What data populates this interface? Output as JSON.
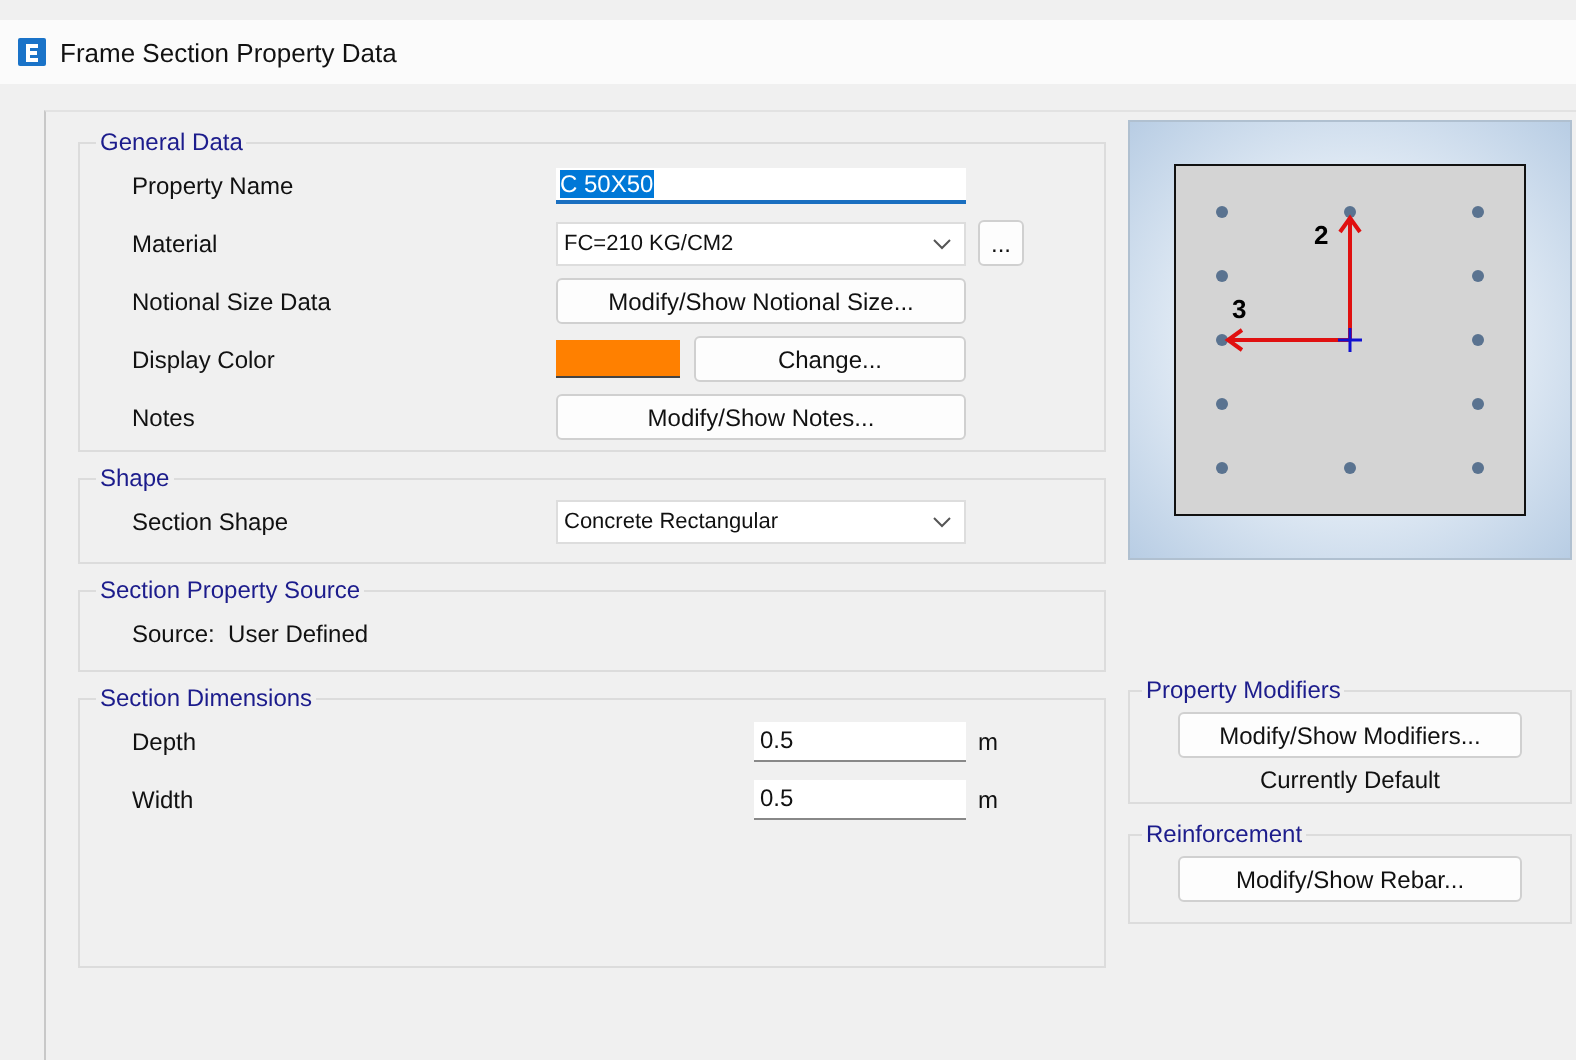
{
  "window": {
    "title": "Frame Section Property Data"
  },
  "general_data": {
    "title": "General Data",
    "rows": [
      {
        "label": "Property Name",
        "kind": "text",
        "value": "C 50X50",
        "selected": true
      },
      {
        "label": "Material",
        "kind": "dropdown",
        "value": "FC=210 KG/CM2",
        "extra_button": "..."
      },
      {
        "label": "Notional Size Data",
        "kind": "button",
        "button": "Modify/Show Notional Size..."
      },
      {
        "label": "Display Color",
        "kind": "color",
        "color": "#ff8000",
        "button": "Change..."
      },
      {
        "label": "Notes",
        "kind": "button",
        "button": "Modify/Show Notes..."
      }
    ]
  },
  "shape": {
    "title": "Shape",
    "label": "Section Shape",
    "value": "Concrete Rectangular"
  },
  "source": {
    "title": "Section Property Source",
    "text": "Source:  User Defined"
  },
  "dimensions": {
    "title": "Section Dimensions",
    "rows": [
      {
        "label": "Depth",
        "value": "0.5",
        "unit": "m"
      },
      {
        "label": "Width",
        "value": "0.5",
        "unit": "m"
      }
    ]
  },
  "preview": {
    "axis_2": "2",
    "axis_3": "3"
  },
  "property_modifiers": {
    "title": "Property Modifiers",
    "button": "Modify/Show Modifiers...",
    "status": "Currently Default"
  },
  "reinforcement": {
    "title": "Reinforcement",
    "button": "Modify/Show Rebar..."
  }
}
